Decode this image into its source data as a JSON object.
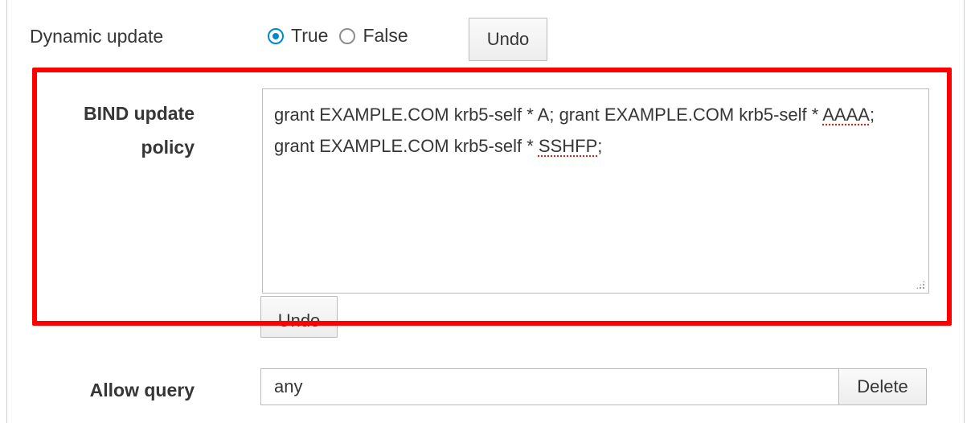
{
  "dynamic_update": {
    "label": "Dynamic update",
    "options": [
      {
        "label": "True",
        "checked": true
      },
      {
        "label": "False",
        "checked": false
      }
    ],
    "undo_label": "Undo"
  },
  "bind_update_policy": {
    "label_line1": "BIND update",
    "label_line2": "policy",
    "value_part1": "grant EXAMPLE.COM krb5-self * A; grant EXAMPLE.COM krb5-self * ",
    "value_spell1": "AAAA",
    "value_part2": "; grant EXAMPLE.COM krb5-self * ",
    "value_spell2": "SSHFP",
    "value_part3": ";",
    "undo_label": "Undo"
  },
  "allow_query": {
    "label": "Allow query",
    "value": "any",
    "delete_label": "Delete"
  },
  "colors": {
    "accent": "#0088ce",
    "highlight": "#ff0000",
    "text": "#363636"
  }
}
